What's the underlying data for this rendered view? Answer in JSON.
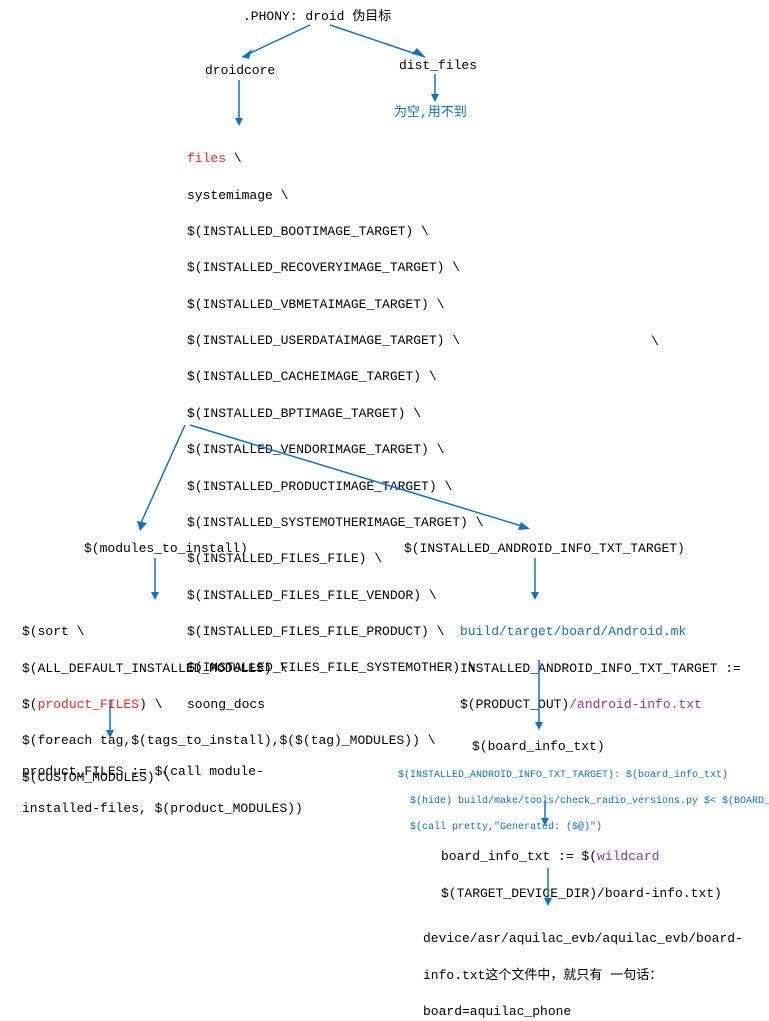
{
  "root": {
    "label": ".PHONY: droid 伪目标"
  },
  "droidcore": {
    "label": "droidcore"
  },
  "dist_files": {
    "label": "dist_files"
  },
  "dist_files_note": {
    "label": "为空,用不到"
  },
  "files_block": {
    "l0": "files",
    "l0b": " \\",
    "l1": "systemimage \\",
    "l2": "$(INSTALLED_BOOTIMAGE_TARGET) \\",
    "l3": "$(INSTALLED_RECOVERYIMAGE_TARGET) \\",
    "l4": "$(INSTALLED_VBMETAIMAGE_TARGET) \\",
    "l5": "$(INSTALLED_USERDATAIMAGE_TARGET) \\",
    "l6": "$(INSTALLED_CACHEIMAGE_TARGET) \\",
    "l7": "$(INSTALLED_BPTIMAGE_TARGET) \\",
    "l8": "$(INSTALLED_VENDORIMAGE_TARGET) \\",
    "l9": "$(INSTALLED_PRODUCTIMAGE_TARGET) \\",
    "l10": "$(INSTALLED_SYSTEMOTHERIMAGE_TARGET) \\",
    "l11": "$(INSTALLED_FILES_FILE) \\",
    "l12": "$(INSTALLED_FILES_FILE_VENDOR) \\",
    "l13": "$(INSTALLED_FILES_FILE_PRODUCT) \\",
    "l14": "$(INSTALLED_FILES_FILE_SYSTEMOTHER) \\",
    "l15": "soong_docs"
  },
  "backslash_stray": "\\",
  "modules_to_install": {
    "label": "$(modules_to_install)"
  },
  "installed_android_info": {
    "label": "$(INSTALLED_ANDROID_INFO_TXT_TARGET)"
  },
  "sort_block": {
    "l0": "$(sort \\",
    "l1": "$(ALL_DEFAULT_INSTALLED_MODULES) \\",
    "l2a": "$(",
    "l2b": "product_FILES",
    "l2c": ") \\",
    "l3": "$(foreach tag,$(tags_to_install),$($(tag)_MODULES)) \\",
    "l4": "$(CUSTOM_MODULES) \\"
  },
  "product_files_block": {
    "l0": "product_FILES := $(call module-",
    "l1": "installed-files, $(product_MODULES))"
  },
  "android_mk_block": {
    "l0": "build/target/board/Android.mk",
    "l1a": "INSTALLED_ANDROID_INFO_TXT_TARGET :=",
    "l1b": "$(PRODUCT_OUT)",
    "l1c": "/android-info.txt"
  },
  "board_info_txt": {
    "label": "$(board_info_txt)"
  },
  "board_info_detail": {
    "l0": "$(INSTALLED_ANDROID_INFO_TXT_TARGET): $(board_info_txt)",
    "l1": "  $(hide) build/make/tools/check_radio_versions.py $< $(BOARD_INFO_CHECK)",
    "l2": "  $(call pretty,\"Generated: ($@)\")"
  },
  "wildcard_block": {
    "l0a": "board_info_txt := $(",
    "l0b": "wildcard",
    "l1": "$(TARGET_DEVICE_DIR)/board-info.txt)"
  },
  "device_block": {
    "l0": "device/asr/aquilac_evb/aquilac_evb/board-",
    "l1": "info.txt这个文件中，就只有 一句话：",
    "l2": "board=aquilac_phone"
  }
}
